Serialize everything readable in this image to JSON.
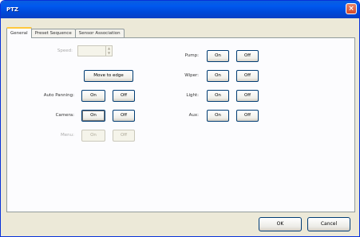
{
  "window": {
    "title": "PTZ",
    "close_icon": "×"
  },
  "tabs": [
    {
      "label": "General",
      "active": true
    },
    {
      "label": "Preset Sequence",
      "active": false
    },
    {
      "label": "Sensor Association",
      "active": false
    }
  ],
  "left": {
    "speed_label": "Speed:",
    "speed_value": "",
    "move_to_edge_label": "Move to edge",
    "auto_panning_label": "Auto Panning:",
    "camera_label": "Camera:",
    "menu_label": "Menu:",
    "on_label": "On",
    "off_label": "Off"
  },
  "right": {
    "pump_label": "Pump:",
    "wiper_label": "Wiper:",
    "light_label": "Light:",
    "aux_label": "Aux:",
    "on_label": "On",
    "off_label": "Off"
  },
  "footer": {
    "ok_label": "OK",
    "cancel_label": "Cancel"
  }
}
